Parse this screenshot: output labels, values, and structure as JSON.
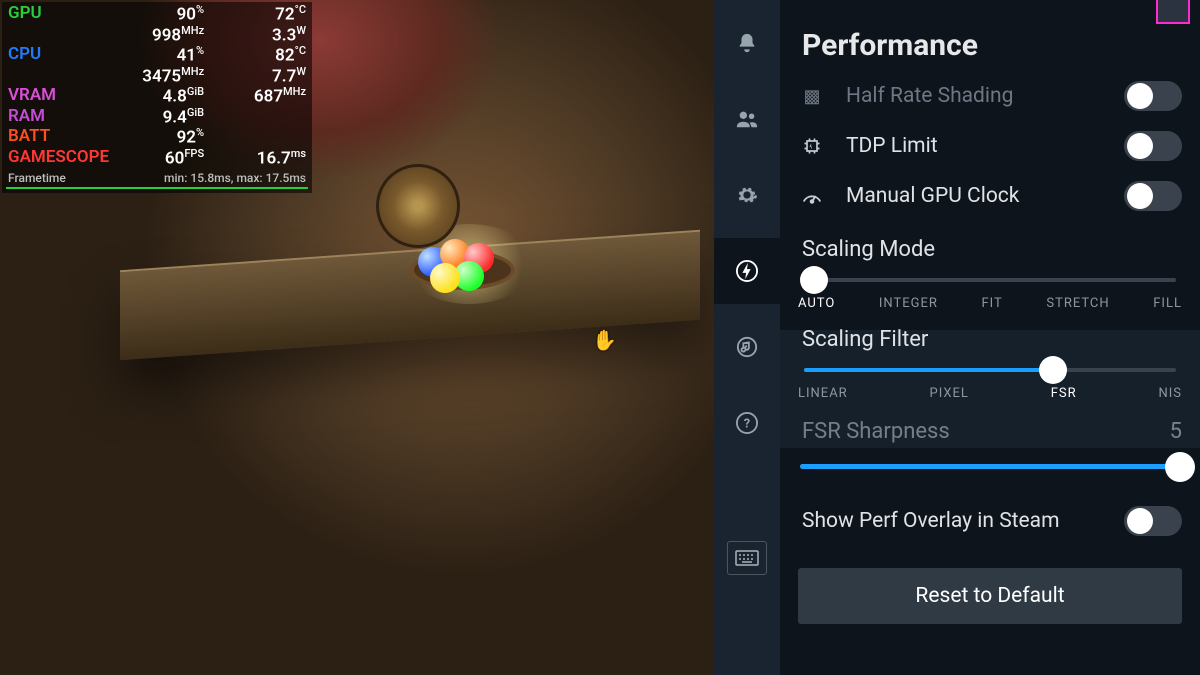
{
  "overlay": {
    "rows": [
      {
        "label": "GPU",
        "class": "c-gpu",
        "v1": "90",
        "u1": "%",
        "v2": "72",
        "u2": "°C"
      },
      {
        "label": "",
        "class": "",
        "v1": "998",
        "u1": "MHz",
        "v2": "3.3",
        "u2": "W"
      },
      {
        "label": "CPU",
        "class": "c-cpu",
        "v1": "41",
        "u1": "%",
        "v2": "82",
        "u2": "°C"
      },
      {
        "label": "",
        "class": "",
        "v1": "3475",
        "u1": "MHz",
        "v2": "7.7",
        "u2": "W"
      },
      {
        "label": "VRAM",
        "class": "c-vram",
        "v1": "4.8",
        "u1": "GiB",
        "v2": "687",
        "u2": "MHz"
      },
      {
        "label": "RAM",
        "class": "c-ram",
        "v1": "9.4",
        "u1": "GiB",
        "v2": "",
        "u2": ""
      },
      {
        "label": "BATT",
        "class": "c-batt",
        "v1": "92",
        "u1": "%",
        "v2": "",
        "u2": ""
      },
      {
        "label": "GAMESCOPE",
        "class": "c-gs",
        "v1": "60",
        "u1": "FPS",
        "v2": "16.7",
        "u2": "ms"
      }
    ],
    "frametime_label": "Frametime",
    "frametime_minmax": "min: 15.8ms, max: 17.5ms"
  },
  "panel": {
    "title": "Performance",
    "half_rate_shading": "Half Rate Shading",
    "tdp_limit": "TDP Limit",
    "manual_gpu_clock": "Manual GPU Clock",
    "scaling_mode": {
      "label": "Scaling Mode",
      "options": [
        "AUTO",
        "INTEGER",
        "FIT",
        "STRETCH",
        "FILL"
      ],
      "index": 0
    },
    "scaling_filter": {
      "label": "Scaling Filter",
      "options": [
        "LINEAR",
        "PIXEL",
        "FSR",
        "NIS"
      ],
      "index": 2
    },
    "fsr_sharpness": {
      "label": "FSR Sharpness",
      "value": 5,
      "max": 5
    },
    "show_perf_overlay": "Show Perf Overlay in Steam",
    "reset": "Reset to Default",
    "toggles": {
      "half_rate": false,
      "tdp": false,
      "gpu_clock": false,
      "overlay": false
    }
  }
}
